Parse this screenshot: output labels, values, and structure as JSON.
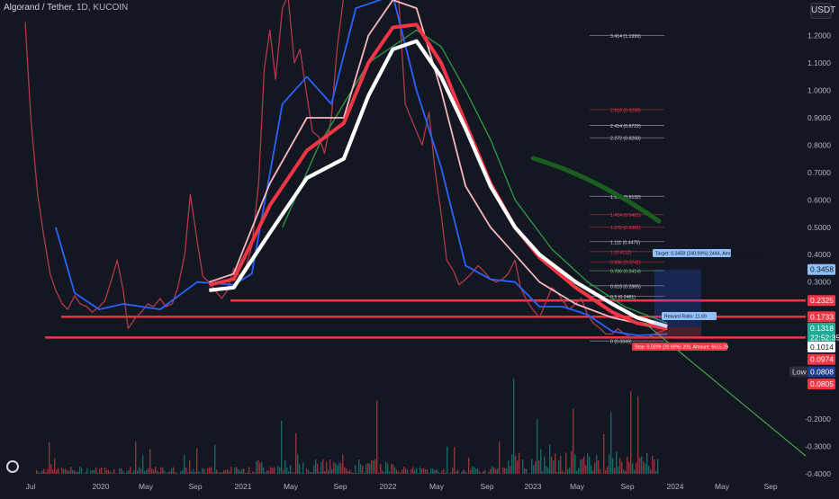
{
  "header": {
    "symbol": "Algorand / Tether",
    "interval": "1D",
    "exchange": "KUCOIN",
    "currency": "USDT"
  },
  "colors": {
    "background": "#131722",
    "price_line": "#b03a48",
    "ma_blue": "#2962ff",
    "ma_white": "#ffffff",
    "ma_red": "#f23645",
    "ma_pink": "#f7b7c0",
    "ma_green": "#2e9b48",
    "level_line": "#f23645",
    "trend_line": "#4caf50"
  },
  "chart_data": {
    "type": "line",
    "title": "",
    "x_ticks": [
      "Jul",
      "2020",
      "May",
      "Sep",
      "2021",
      "May",
      "Sep",
      "2022",
      "May",
      "Sep",
      "2023",
      "May",
      "Sep",
      "2024",
      "May",
      "Sep"
    ],
    "y_ticks": [
      "1.2000",
      "1.1000",
      "1.0000",
      "0.9000",
      "0.8000",
      "0.7000",
      "0.6000",
      "0.5000",
      "0.4000",
      "0.3000",
      "-0.2000",
      "-0.3000",
      "-0.4000"
    ],
    "ylim": [
      -0.43,
      1.33
    ],
    "series": [
      {
        "key": "price",
        "values": [
          [
            "2019-07-01",
            1.25
          ],
          [
            "2019-07-15",
            0.9
          ],
          [
            "2019-08-01",
            0.62
          ],
          [
            "2019-08-15",
            0.48
          ],
          [
            "2019-09-01",
            0.33
          ],
          [
            "2019-09-15",
            0.27
          ],
          [
            "2019-10-01",
            0.22
          ],
          [
            "2019-10-15",
            0.2
          ],
          [
            "2019-11-01",
            0.25
          ],
          [
            "2019-11-15",
            0.22
          ],
          [
            "2019-12-01",
            0.21
          ],
          [
            "2019-12-15",
            0.19
          ],
          [
            "2020-01-01",
            0.21
          ],
          [
            "2020-01-15",
            0.23
          ],
          [
            "2020-02-01",
            0.31
          ],
          [
            "2020-02-15",
            0.38
          ],
          [
            "2020-03-01",
            0.27
          ],
          [
            "2020-03-13",
            0.13
          ],
          [
            "2020-04-01",
            0.17
          ],
          [
            "2020-04-15",
            0.19
          ],
          [
            "2020-05-01",
            0.22
          ],
          [
            "2020-05-15",
            0.21
          ],
          [
            "2020-06-01",
            0.24
          ],
          [
            "2020-06-15",
            0.21
          ],
          [
            "2020-07-01",
            0.22
          ],
          [
            "2020-07-15",
            0.28
          ],
          [
            "2020-08-01",
            0.4
          ],
          [
            "2020-08-15",
            0.62
          ],
          [
            "2020-09-01",
            0.45
          ],
          [
            "2020-09-15",
            0.32
          ],
          [
            "2020-10-01",
            0.3
          ],
          [
            "2020-10-15",
            0.27
          ],
          [
            "2020-11-01",
            0.24
          ],
          [
            "2020-11-15",
            0.27
          ],
          [
            "2020-12-01",
            0.35
          ],
          [
            "2020-12-15",
            0.32
          ],
          [
            "2021-01-01",
            0.36
          ],
          [
            "2021-01-15",
            0.43
          ],
          [
            "2021-02-01",
            0.66
          ],
          [
            "2021-02-15",
            1.08
          ],
          [
            "2021-03-01",
            1.22
          ],
          [
            "2021-03-15",
            1.04
          ],
          [
            "2021-04-01",
            1.3
          ],
          [
            "2021-04-15",
            1.55
          ],
          [
            "2021-05-01",
            1.1
          ],
          [
            "2021-05-15",
            1.15
          ],
          [
            "2021-06-01",
            0.98
          ],
          [
            "2021-06-15",
            0.85
          ],
          [
            "2021-07-01",
            0.83
          ],
          [
            "2021-07-15",
            0.77
          ],
          [
            "2021-08-01",
            0.9
          ],
          [
            "2021-08-15",
            1.15
          ],
          [
            "2021-09-01",
            1.4
          ],
          [
            "2021-09-15",
            1.85
          ],
          [
            "2021-10-01",
            1.9
          ],
          [
            "2021-10-15",
            1.7
          ],
          [
            "2021-11-01",
            1.9
          ],
          [
            "2021-11-15",
            1.7
          ],
          [
            "2021-12-01",
            1.6
          ],
          [
            "2021-12-15",
            1.4
          ],
          [
            "2022-01-01",
            1.5
          ],
          [
            "2022-01-15",
            1.5
          ],
          [
            "2022-02-01",
            0.95
          ],
          [
            "2022-02-15",
            0.9
          ],
          [
            "2022-03-01",
            0.85
          ],
          [
            "2022-03-15",
            0.8
          ],
          [
            "2022-04-01",
            0.92
          ],
          [
            "2022-04-15",
            0.72
          ],
          [
            "2022-05-01",
            0.55
          ],
          [
            "2022-05-15",
            0.38
          ],
          [
            "2022-06-01",
            0.34
          ],
          [
            "2022-06-15",
            0.29
          ],
          [
            "2022-07-01",
            0.31
          ],
          [
            "2022-07-15",
            0.33
          ],
          [
            "2022-08-01",
            0.36
          ],
          [
            "2022-08-15",
            0.34
          ],
          [
            "2022-09-01",
            0.31
          ],
          [
            "2022-09-15",
            0.3
          ],
          [
            "2022-10-01",
            0.31
          ],
          [
            "2022-10-15",
            0.33
          ],
          [
            "2022-11-01",
            0.38
          ],
          [
            "2022-11-15",
            0.28
          ],
          [
            "2022-12-01",
            0.23
          ],
          [
            "2022-12-15",
            0.2
          ],
          [
            "2023-01-01",
            0.17
          ],
          [
            "2023-01-15",
            0.22
          ],
          [
            "2023-02-01",
            0.28
          ],
          [
            "2023-02-15",
            0.26
          ],
          [
            "2023-03-01",
            0.23
          ],
          [
            "2023-03-15",
            0.2
          ],
          [
            "2023-04-01",
            0.22
          ],
          [
            "2023-04-15",
            0.24
          ],
          [
            "2023-05-01",
            0.18
          ],
          [
            "2023-05-15",
            0.15
          ],
          [
            "2023-06-01",
            0.13
          ],
          [
            "2023-06-15",
            0.11
          ],
          [
            "2023-07-01",
            0.11
          ],
          [
            "2023-07-15",
            0.13
          ],
          [
            "2023-08-01",
            0.11
          ],
          [
            "2023-08-15",
            0.1
          ],
          [
            "2023-09-01",
            0.1
          ],
          [
            "2023-09-15",
            0.1
          ],
          [
            "2023-10-01",
            0.1
          ],
          [
            "2023-10-15",
            0.11
          ],
          [
            "2023-11-01",
            0.12
          ],
          [
            "2023-11-15",
            0.13
          ]
        ]
      },
      {
        "key": "ma_blue",
        "values": [
          [
            "2019-09-15",
            0.5
          ],
          [
            "2019-11-01",
            0.26
          ],
          [
            "2020-01-01",
            0.2
          ],
          [
            "2020-03-01",
            0.22
          ],
          [
            "2020-06-01",
            0.2
          ],
          [
            "2020-09-01",
            0.3
          ],
          [
            "2020-12-01",
            0.29
          ],
          [
            "2021-01-15",
            0.33
          ],
          [
            "2021-04-01",
            0.95
          ],
          [
            "2021-06-01",
            1.05
          ],
          [
            "2021-08-01",
            0.95
          ],
          [
            "2021-10-01",
            1.3
          ],
          [
            "2022-01-01",
            1.4
          ],
          [
            "2022-03-01",
            1.0
          ],
          [
            "2022-05-01",
            0.72
          ],
          [
            "2022-07-01",
            0.36
          ],
          [
            "2022-09-01",
            0.31
          ],
          [
            "2022-11-01",
            0.3
          ],
          [
            "2023-01-01",
            0.21
          ],
          [
            "2023-03-01",
            0.21
          ],
          [
            "2023-05-01",
            0.18
          ],
          [
            "2023-07-01",
            0.12
          ],
          [
            "2023-09-01",
            0.105
          ],
          [
            "2023-11-15",
            0.11
          ]
        ]
      },
      {
        "key": "ma_white",
        "values": [
          [
            "2020-10-01",
            0.27
          ],
          [
            "2020-12-01",
            0.28
          ],
          [
            "2021-03-01",
            0.48
          ],
          [
            "2021-06-01",
            0.68
          ],
          [
            "2021-09-01",
            0.75
          ],
          [
            "2021-11-01",
            0.98
          ],
          [
            "2022-01-01",
            1.15
          ],
          [
            "2022-03-01",
            1.18
          ],
          [
            "2022-05-01",
            1.05
          ],
          [
            "2022-07-01",
            0.86
          ],
          [
            "2022-09-01",
            0.65
          ],
          [
            "2022-11-01",
            0.5
          ],
          [
            "2023-01-01",
            0.4
          ],
          [
            "2023-04-01",
            0.3
          ],
          [
            "2023-07-01",
            0.22
          ],
          [
            "2023-09-01",
            0.17
          ],
          [
            "2023-11-15",
            0.138
          ]
        ]
      },
      {
        "key": "ma_red",
        "values": [
          [
            "2020-10-01",
            0.29
          ],
          [
            "2020-12-01",
            0.31
          ],
          [
            "2021-03-01",
            0.58
          ],
          [
            "2021-06-01",
            0.78
          ],
          [
            "2021-09-01",
            0.88
          ],
          [
            "2021-11-01",
            1.1
          ],
          [
            "2022-01-01",
            1.23
          ],
          [
            "2022-03-01",
            1.24
          ],
          [
            "2022-05-01",
            1.1
          ],
          [
            "2022-07-01",
            0.88
          ],
          [
            "2022-09-01",
            0.66
          ],
          [
            "2022-11-01",
            0.5
          ],
          [
            "2023-01-01",
            0.39
          ],
          [
            "2023-04-01",
            0.28
          ],
          [
            "2023-07-01",
            0.19
          ],
          [
            "2023-09-01",
            0.15
          ],
          [
            "2023-11-15",
            0.13
          ]
        ]
      },
      {
        "key": "ma_pink",
        "values": [
          [
            "2020-10-01",
            0.3
          ],
          [
            "2020-12-01",
            0.33
          ],
          [
            "2021-03-01",
            0.66
          ],
          [
            "2021-06-01",
            0.9
          ],
          [
            "2021-09-01",
            0.9
          ],
          [
            "2021-11-01",
            1.2
          ],
          [
            "2022-01-01",
            1.33
          ],
          [
            "2022-03-01",
            1.3
          ],
          [
            "2022-05-01",
            1.0
          ],
          [
            "2022-07-01",
            0.65
          ],
          [
            "2022-09-01",
            0.5
          ],
          [
            "2022-11-01",
            0.4
          ],
          [
            "2023-01-01",
            0.3
          ],
          [
            "2023-04-01",
            0.22
          ],
          [
            "2023-07-01",
            0.17
          ],
          [
            "2023-09-01",
            0.15
          ],
          [
            "2023-11-15",
            0.14
          ]
        ]
      },
      {
        "key": "ma_green",
        "values": [
          [
            "2021-04-01",
            0.5
          ],
          [
            "2021-07-01",
            0.8
          ],
          [
            "2021-11-01",
            1.1
          ],
          [
            "2022-03-01",
            1.22
          ],
          [
            "2022-05-01",
            1.16
          ],
          [
            "2022-07-01",
            1.0
          ],
          [
            "2022-09-01",
            0.82
          ],
          [
            "2022-11-01",
            0.6
          ],
          [
            "2023-02-01",
            0.42
          ],
          [
            "2023-05-01",
            0.3
          ],
          [
            "2023-08-01",
            0.21
          ],
          [
            "2023-11-15",
            0.15
          ]
        ]
      }
    ],
    "horizontal_levels": [
      0.2325,
      0.1733,
      0.0974
    ],
    "fib_labels": [
      {
        "text": "3.414 (1.1999)",
        "value": 1.1999,
        "color": "#d1d4dc"
      },
      {
        "text": "2.618 (0.9298)",
        "value": 0.9298,
        "color": "#f23645"
      },
      {
        "text": "2.414 (0.8722)",
        "value": 0.8722,
        "color": "#d1d4dc"
      },
      {
        "text": "2.272 (0.8268)",
        "value": 0.8268,
        "color": "#d1d4dc"
      },
      {
        "text": "1.618 (0.6132)",
        "value": 0.6132,
        "color": "#d1d4dc"
      },
      {
        "text": "1.414 (0.5461)",
        "value": 0.5461,
        "color": "#f23645"
      },
      {
        "text": "1.272 (0.5001)",
        "value": 0.5001,
        "color": "#f23645"
      },
      {
        "text": "1.111 (0.4475)",
        "value": 0.4475,
        "color": "#d1d4dc"
      },
      {
        "text": "1 (0.4112)",
        "value": 0.4112,
        "color": "#f23645"
      },
      {
        "text": "0.886 (0.3741)",
        "value": 0.3741,
        "color": "#f23645"
      },
      {
        "text": "0.786 (0.3414)",
        "value": 0.3414,
        "color": "#81c784"
      },
      {
        "text": "0.618 (0.2865)",
        "value": 0.2865,
        "color": "#d1d4dc"
      },
      {
        "text": "0.5 (0.2481)",
        "value": 0.2481,
        "color": "#d1d4dc"
      },
      {
        "text": "0 (0.0849)",
        "value": 0.0849,
        "color": "#d1d4dc"
      }
    ],
    "annotations": {
      "target": "Target: 0.3458 (240.99%) 2444, Amount: 21109.92",
      "reward_ratio": "Reward Ratio: 11.69",
      "stop": "Stop: 0.0209 (20.60%) 209, Amount: 6515.29"
    },
    "price_labels": [
      {
        "text": "0.3458",
        "value": 0.3458,
        "bg": "#90bff9",
        "fg": "#131722"
      },
      {
        "text": "0.2325",
        "value": 0.2325,
        "bg": "#f23645",
        "fg": "#ffffff"
      },
      {
        "text": "0.1733",
        "value": 0.1733,
        "bg": "#f23645",
        "fg": "#ffffff"
      },
      {
        "text": "0.1318",
        "value": 0.1318,
        "bg": "#22ab94",
        "fg": "#ffffff"
      },
      {
        "text": "22:52:35",
        "value": 0.0974,
        "bg": "#22ab94",
        "fg": "#ffffff"
      },
      {
        "text": "0.1014",
        "value": 0.0624,
        "bg": "#ffffff",
        "fg": "#131722"
      },
      {
        "text": "0.0974",
        "value": 0.0174,
        "bg": "#f23645",
        "fg": "#ffffff"
      },
      {
        "text": "0.0808",
        "value": -0.0276,
        "bg": "#1e3a8a",
        "fg": "#ffffff",
        "prefix": "Low"
      },
      {
        "text": "0.0805",
        "value": -0.0726,
        "bg": "#f23645",
        "fg": "#ffffff"
      }
    ]
  }
}
